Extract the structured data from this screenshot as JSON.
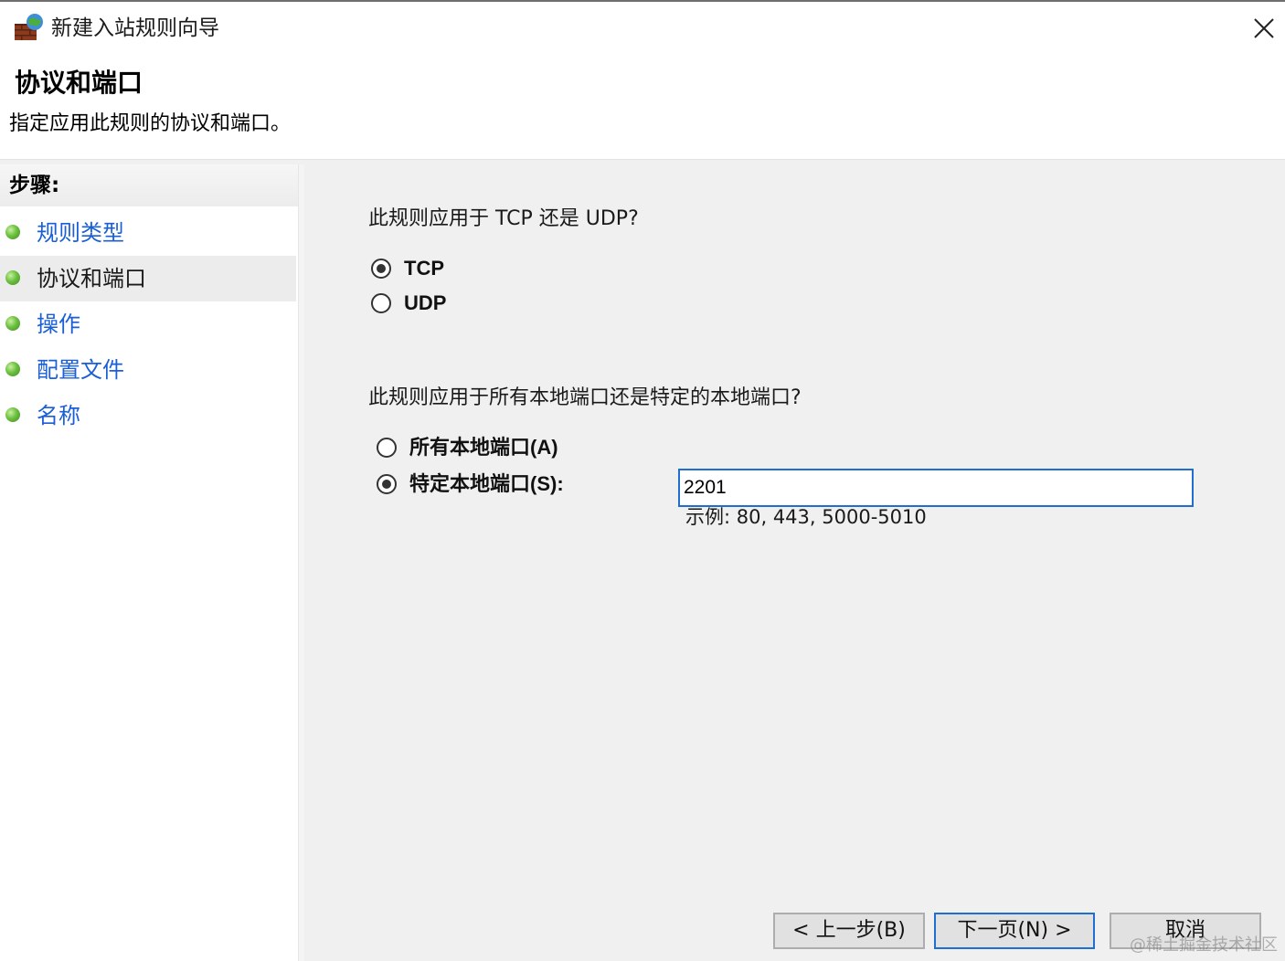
{
  "window": {
    "title": "新建入站规则向导",
    "icon": "firewall-icon"
  },
  "header": {
    "title": "协议和端口",
    "subtitle": "指定应用此规则的协议和端口。"
  },
  "sidebar": {
    "steps_label": "步骤:",
    "items": [
      {
        "label": "规则类型",
        "active": false
      },
      {
        "label": "协议和端口",
        "active": true
      },
      {
        "label": "操作",
        "active": false
      },
      {
        "label": "配置文件",
        "active": false
      },
      {
        "label": "名称",
        "active": false
      }
    ]
  },
  "main": {
    "protocol_question": "此规则应用于 TCP 还是 UDP?",
    "protocol_options": [
      {
        "label": "TCP",
        "checked": true
      },
      {
        "label": "UDP",
        "checked": false
      }
    ],
    "port_question": "此规则应用于所有本地端口还是特定的本地端口?",
    "port_options": [
      {
        "label": "所有本地端口(A)",
        "checked": false
      },
      {
        "label": "特定本地端口(S):",
        "checked": true
      }
    ],
    "port_value": "2201",
    "port_example": "示例: 80, 443, 5000-5010"
  },
  "buttons": {
    "back": "< 上一步(B)",
    "next": "下一页(N) >",
    "cancel": "取消"
  },
  "watermark": "@稀土掘金技术社区"
}
